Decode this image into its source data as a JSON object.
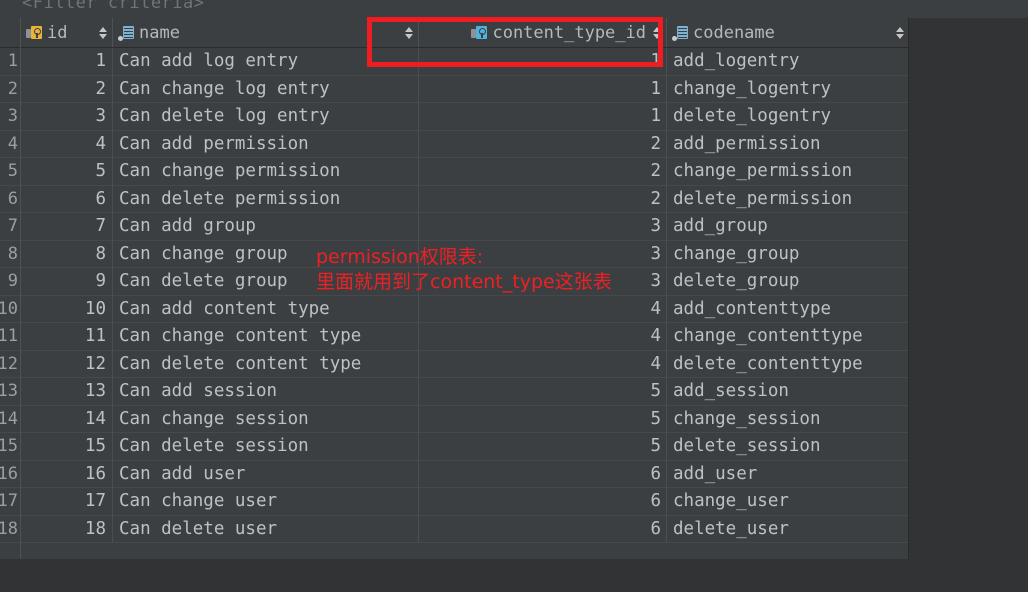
{
  "filter": {
    "placeholder_text": "<Filter criteria>"
  },
  "table": {
    "columns": [
      {
        "key": "id",
        "label": "id",
        "icon": "primary-key-column-icon",
        "sortable": true,
        "align": "right"
      },
      {
        "key": "name",
        "label": "name",
        "icon": "column-icon",
        "sortable": true,
        "align": "left"
      },
      {
        "key": "content_type_id",
        "label": "content_type_id",
        "icon": "foreign-key-column-icon",
        "sortable": true,
        "align": "right"
      },
      {
        "key": "codename",
        "label": "codename",
        "icon": "column-icon",
        "sortable": true,
        "align": "left"
      }
    ],
    "rows": [
      {
        "n": "1",
        "id": "1",
        "name": "Can add log entry",
        "content_type_id": "1",
        "codename": "add_logentry"
      },
      {
        "n": "2",
        "id": "2",
        "name": "Can change log entry",
        "content_type_id": "1",
        "codename": "change_logentry"
      },
      {
        "n": "3",
        "id": "3",
        "name": "Can delete log entry",
        "content_type_id": "1",
        "codename": "delete_logentry"
      },
      {
        "n": "4",
        "id": "4",
        "name": "Can add permission",
        "content_type_id": "2",
        "codename": "add_permission"
      },
      {
        "n": "5",
        "id": "5",
        "name": "Can change permission",
        "content_type_id": "2",
        "codename": "change_permission"
      },
      {
        "n": "6",
        "id": "6",
        "name": "Can delete permission",
        "content_type_id": "2",
        "codename": "delete_permission"
      },
      {
        "n": "7",
        "id": "7",
        "name": "Can add group",
        "content_type_id": "3",
        "codename": "add_group"
      },
      {
        "n": "8",
        "id": "8",
        "name": "Can change group",
        "content_type_id": "3",
        "codename": "change_group"
      },
      {
        "n": "9",
        "id": "9",
        "name": "Can delete group",
        "content_type_id": "3",
        "codename": "delete_group"
      },
      {
        "n": "10",
        "id": "10",
        "name": "Can add content type",
        "content_type_id": "4",
        "codename": "add_contenttype"
      },
      {
        "n": "11",
        "id": "11",
        "name": "Can change content type",
        "content_type_id": "4",
        "codename": "change_contenttype"
      },
      {
        "n": "12",
        "id": "12",
        "name": "Can delete content type",
        "content_type_id": "4",
        "codename": "delete_contenttype"
      },
      {
        "n": "13",
        "id": "13",
        "name": "Can add session",
        "content_type_id": "5",
        "codename": "add_session"
      },
      {
        "n": "14",
        "id": "14",
        "name": "Can change session",
        "content_type_id": "5",
        "codename": "change_session"
      },
      {
        "n": "15",
        "id": "15",
        "name": "Can delete session",
        "content_type_id": "5",
        "codename": "delete_session"
      },
      {
        "n": "16",
        "id": "16",
        "name": "Can add user",
        "content_type_id": "6",
        "codename": "add_user"
      },
      {
        "n": "17",
        "id": "17",
        "name": "Can change user",
        "content_type_id": "6",
        "codename": "change_user"
      },
      {
        "n": "18",
        "id": "18",
        "name": "Can delete user",
        "content_type_id": "6",
        "codename": "delete_user"
      }
    ]
  },
  "annotations": {
    "highlight_column": "content_type_id",
    "line1": "permission权限表:",
    "line2": "里面就用到了content_type这张表",
    "color": "#ee2024"
  }
}
